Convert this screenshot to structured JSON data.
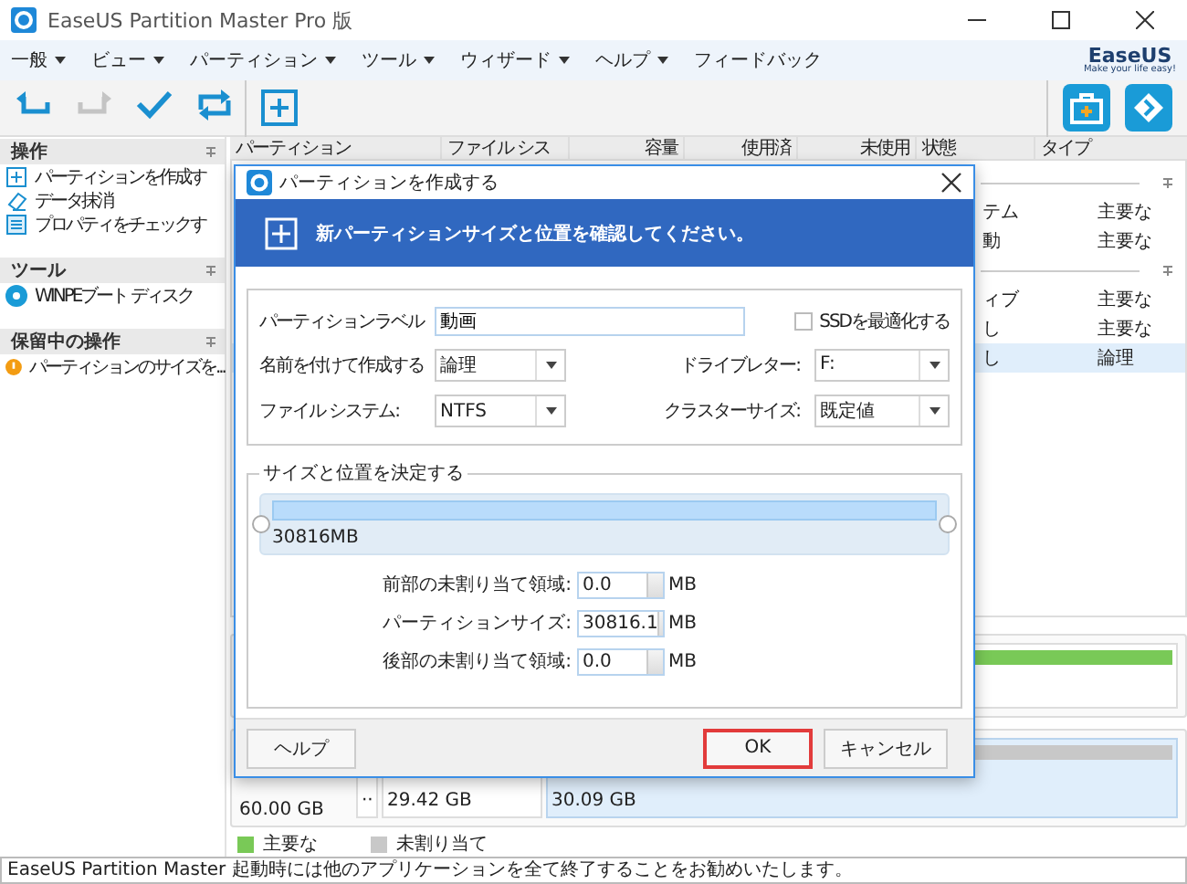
{
  "window": {
    "title": "EaseUS Partition Master Pro 版"
  },
  "menu": [
    {
      "label": "一般",
      "has_dropdown": true
    },
    {
      "label": "ビュー",
      "has_dropdown": true
    },
    {
      "label": "パーティション",
      "has_dropdown": true
    },
    {
      "label": "ツール",
      "has_dropdown": true
    },
    {
      "label": "ウィザード",
      "has_dropdown": true
    },
    {
      "label": "ヘルプ",
      "has_dropdown": true
    },
    {
      "label": "フィードバック",
      "has_dropdown": false
    }
  ],
  "brand": {
    "name": "EaseUS",
    "tagline": "Make your life easy!"
  },
  "toolbar": {
    "left": [
      {
        "kind": "undo",
        "disabled": false
      },
      {
        "kind": "redo",
        "disabled": true
      },
      {
        "kind": "apply",
        "disabled": false
      },
      {
        "kind": "refresh",
        "disabled": false
      }
    ],
    "middle": [
      {
        "kind": "add",
        "disabled": false
      }
    ],
    "right": [
      {
        "kind": "toolbox"
      },
      {
        "kind": "forward"
      }
    ]
  },
  "sidebar": {
    "sections": [
      {
        "title": "操作",
        "items": [
          {
            "kind": "plus",
            "label": "パーティションを作成す"
          },
          {
            "kind": "eraser",
            "label": "データ抹消"
          },
          {
            "kind": "document",
            "label": "プロパティをチェックす"
          }
        ]
      },
      {
        "title": "ツール",
        "items": [
          {
            "kind": "disc",
            "label": "WINPEブート ディスク"
          }
        ]
      },
      {
        "title": "保留中の操作",
        "items": [
          {
            "kind": "warning",
            "label": "パーティションのサイズを..."
          }
        ]
      }
    ]
  },
  "table": {
    "columns": [
      "パーティション",
      "ファイル シス",
      "容量",
      "使用済",
      "未使用",
      "状態",
      "タイプ"
    ],
    "groups": [
      {
        "rows": [
          {
            "status": "テム",
            "type": "主要な",
            "selected": false
          },
          {
            "status": "動",
            "type": "主要な",
            "selected": false
          }
        ]
      },
      {
        "rows": [
          {
            "status": "ィブ",
            "type": "主要な",
            "selected": false
          },
          {
            "status": "し",
            "type": "主要な",
            "selected": false
          },
          {
            "status": "し",
            "type": "論理",
            "selected": true
          }
        ]
      }
    ]
  },
  "disks": [
    {
      "segments": [
        {
          "kind": "primary",
          "selected": false
        }
      ]
    },
    {
      "size": "60.00 GB",
      "segments": [
        {
          "kind": "other",
          "label": "··",
          "selected": false
        },
        {
          "kind": "primary",
          "label": "29.42 GB",
          "selected": false
        },
        {
          "kind": "unallocated",
          "label": "30.09 GB",
          "selected": true
        }
      ]
    }
  ],
  "legend": [
    {
      "label": "主要な",
      "color": "#79c957"
    },
    {
      "label": "未割り当て",
      "color": "#c8c8c8"
    }
  ],
  "status_bar": "EaseUS Partition Master 起動時には他のアプリケーションを全て終了することをお勧めいたします。",
  "dialog": {
    "title": "パーティションを作成する",
    "header": "新パーティションサイズと位置を確認してください。",
    "form_rows": [
      [
        {
          "kind": "text",
          "label": "パーティションラベル",
          "value": "動画"
        },
        {
          "kind": "checkbox",
          "label": "SSDを最適化する",
          "checked": false
        }
      ],
      [
        {
          "kind": "select",
          "label": "名前を付けて作成する",
          "value": "論理"
        },
        {
          "kind": "select",
          "label": "ドライブレター:",
          "value": "F:"
        }
      ],
      [
        {
          "kind": "select",
          "label": "ファイル システム:",
          "value": "NTFS"
        },
        {
          "kind": "select",
          "label": "クラスターサイズ:",
          "value": "既定値"
        }
      ]
    ],
    "size_group": {
      "title": "サイズと位置を決定する",
      "bar_label": "30816MB",
      "level": 1
    },
    "size_rows": [
      {
        "label": "前部の未割り当て領域:",
        "value": "0.0",
        "unit": "MB"
      },
      {
        "label": "パーティションサイズ:",
        "value": "30816.1",
        "unit": "MB"
      },
      {
        "label": "後部の未割り当て領域:",
        "value": "0.0",
        "unit": "MB"
      }
    ],
    "buttons": [
      {
        "label": "ヘルプ",
        "highlighted": false
      },
      {
        "label": "OK",
        "highlighted": true
      },
      {
        "label": "キャンセル",
        "highlighted": false
      }
    ]
  }
}
